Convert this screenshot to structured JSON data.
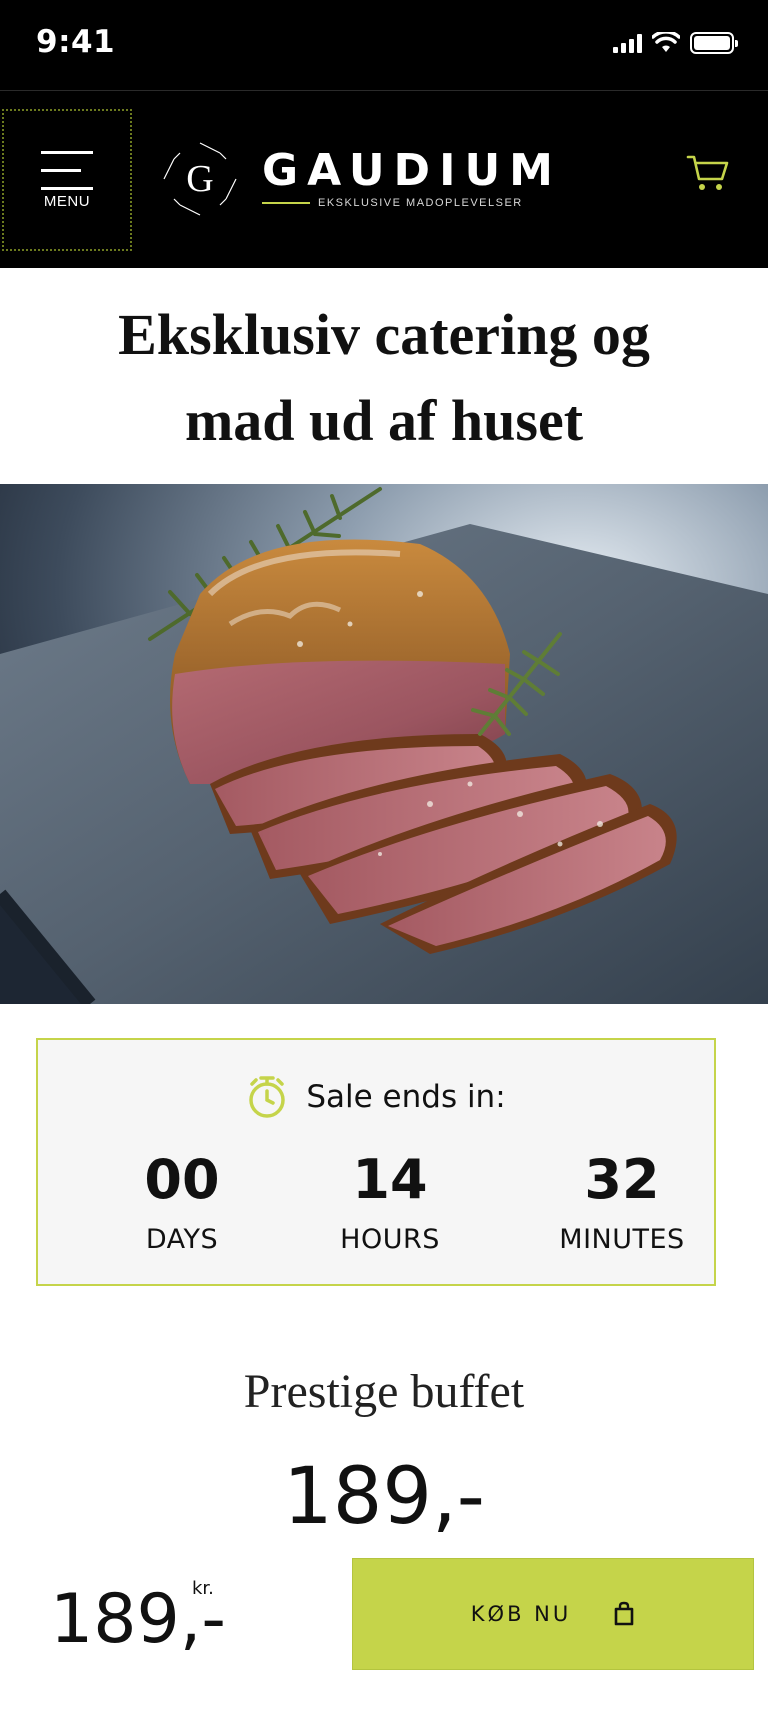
{
  "status_bar": {
    "time": "9:41"
  },
  "header": {
    "menu_label": "MENU",
    "logo_letter": "G",
    "logo_name": "GAUDIUM",
    "logo_tagline": "EKSKLUSIVE MADOPLEVELSER",
    "accent_color": "#c5d44a"
  },
  "page": {
    "title_line1": "Eksklusiv catering og",
    "title_line2": "mad ud af huset"
  },
  "countdown": {
    "heading": "Sale ends in:",
    "units": [
      {
        "value": "00",
        "label": "DAYS"
      },
      {
        "value": "14",
        "label": "HOURS"
      },
      {
        "value": "32",
        "label": "MINUTES"
      }
    ]
  },
  "product": {
    "name": "Prestige buffet",
    "price": "189,-"
  },
  "bottom_bar": {
    "price": "189,-",
    "currency": "kr.",
    "buy_label": "KØB NU"
  },
  "icons": {
    "menu": "hamburger-icon",
    "cart": "cart-icon",
    "timer": "stopwatch-icon",
    "bag": "shopping-bag-icon"
  }
}
